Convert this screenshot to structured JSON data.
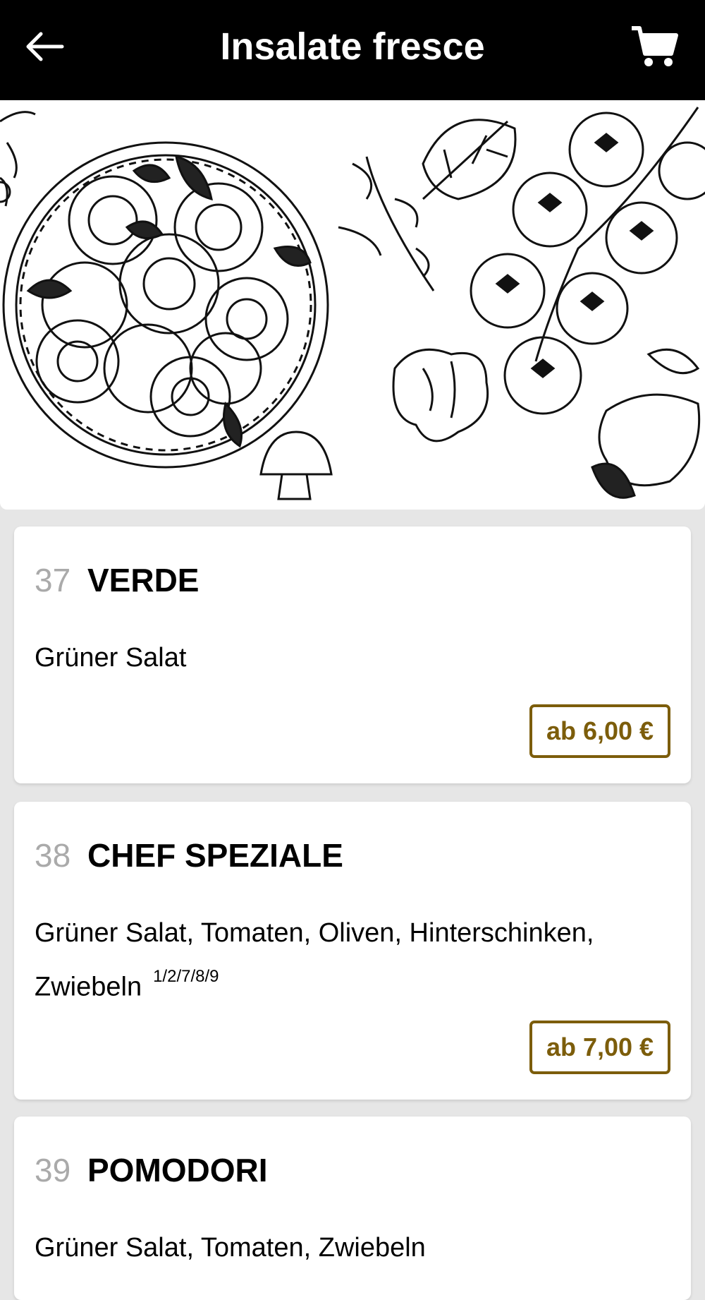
{
  "header": {
    "title": "Insalate fresce",
    "back_icon": "arrow-left-icon",
    "cart_icon": "shopping-cart-icon"
  },
  "hero": {
    "image": "salad-illustration"
  },
  "colors": {
    "header_bg": "#000000",
    "accent": "#7c5d0b",
    "number_grey": "#aaaaaa"
  },
  "items": [
    {
      "number": "37",
      "name": "VERDE",
      "description": "Grüner Salat",
      "allergens": "",
      "price": "ab 6,00 €"
    },
    {
      "number": "38",
      "name": "CHEF SPEZIALE",
      "description": "Grüner Salat, Tomaten, Oliven, Hinterschinken, Zwiebeln",
      "allergens": "1/2/7/8/9",
      "price": "ab 7,00 €"
    },
    {
      "number": "39",
      "name": "POMODORI",
      "description": "Grüner Salat, Tomaten, Zwiebeln",
      "allergens": "",
      "price": ""
    }
  ]
}
